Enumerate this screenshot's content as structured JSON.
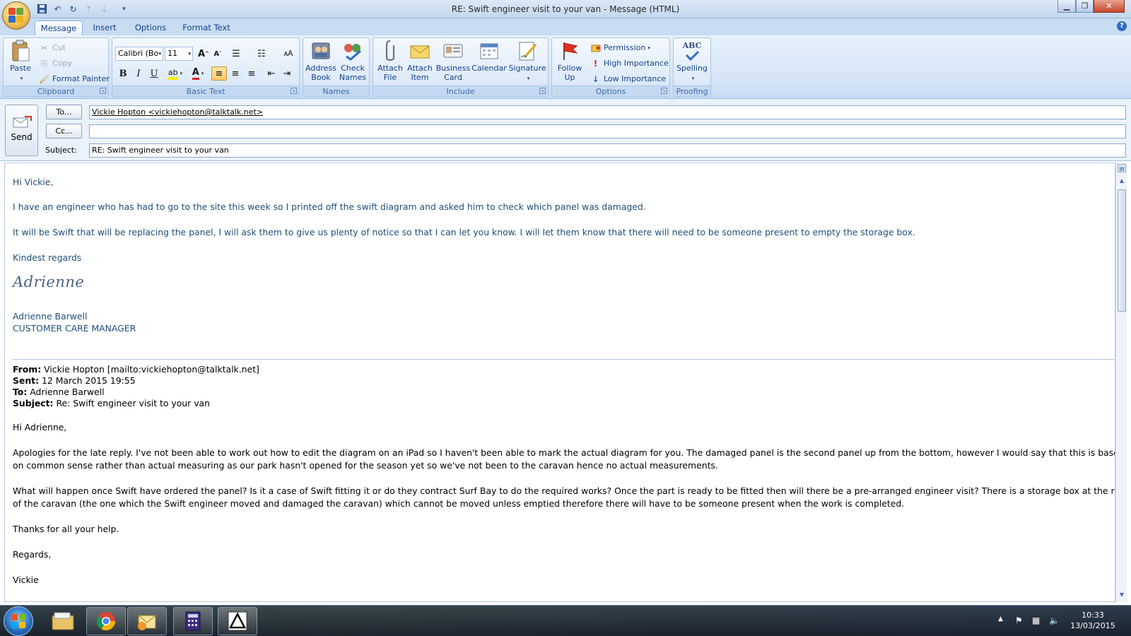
{
  "window": {
    "title": "RE: Swift engineer visit to your van - Message (HTML)",
    "qat_icons": [
      "save-icon",
      "undo-icon",
      "redo-icon",
      "up-arrow-icon",
      "down-arrow-icon",
      "customize-icon"
    ]
  },
  "tabs": [
    "Message",
    "Insert",
    "Options",
    "Format Text"
  ],
  "ribbon": {
    "clipboard": {
      "label": "Clipboard",
      "paste": "Paste",
      "cut": "Cut",
      "copy": "Copy",
      "format_painter": "Format Painter"
    },
    "basic_text": {
      "label": "Basic Text",
      "font": "Calibri (Bo",
      "size": "11"
    },
    "names": {
      "label": "Names",
      "address_book": "Address Book",
      "check_names": "Check Names"
    },
    "include": {
      "label": "Include",
      "attach_file": "Attach File",
      "attach_item": "Attach Item",
      "business_card": "Business Card",
      "calendar": "Calendar",
      "signature": "Signature"
    },
    "options": {
      "label": "Options",
      "follow_up": "Follow Up",
      "permission": "Permission",
      "high_importance": "High Importance",
      "low_importance": "Low Importance"
    },
    "proofing": {
      "label": "Proofing",
      "spelling": "Spelling",
      "abc": "ABC"
    }
  },
  "header": {
    "send": "Send",
    "to_button": "To...",
    "cc_button": "Cc...",
    "subject_label": "Subject:",
    "to_value": "Vickie Hopton <vickiehopton@talktalk.net>",
    "cc_value": "",
    "subject_value": "RE: Swift engineer visit to your van"
  },
  "body": {
    "greeting": "Hi Vickie,",
    "p1": "I have an engineer who has had to go to the site this week so I printed off the swift diagram and asked him to check which panel was damaged.",
    "p2": "It will be Swift that will be replacing the panel, I will ask them to give us plenty of notice so that I can let you know.  I will let them know that there will need to be someone present to empty the storage box.",
    "closing": "Kindest regards",
    "signature_script": "Adrienne",
    "sig_name": "Adrienne Barwell",
    "sig_title": "CUSTOMER CARE MANAGER",
    "quoted": {
      "from_label": "From:",
      "from": "Vickie Hopton [mailto:vickiehopton@talktalk.net]",
      "sent_label": "Sent:",
      "sent": "12 March 2015 19:55",
      "to_label": "To:",
      "to": "Adrienne Barwell",
      "subject_label": "Subject:",
      "subject": "Re: Swift engineer visit to your van",
      "greeting": "Hi Adrienne,",
      "p1a": "Apologies for the late reply.  I've not been able to work out how to edit the diagram on an iPad so I haven't been able to mark the actual diagram for you.  The damaged panel is the second panel up from the bottom, however I would say that this is based",
      "p1b": "on common sense rather than actual measuring as our park hasn't opened for the season yet so we've not been to the caravan  hence no actual measurements.",
      "p2a": "What will happen once Swift have ordered the panel?  Is it a case of Swift fitting it or do they contract Surf Bay to do the required works?  Once the part is ready to be fitted then will there be a pre-arranged engineer visit?  There is a storage box at the rear",
      "p2b": "of the caravan (the one which the Swift engineer moved and damaged the caravan) which cannot be moved unless emptied therefore there will have to be someone present when the work is completed.",
      "thanks": "Thanks for all your help.",
      "regards": "Regards,",
      "name": "Vickie"
    }
  },
  "taskbar": {
    "time": "10:33",
    "date": "13/03/2015",
    "items": [
      "explorer-icon",
      "chrome-icon",
      "outlook-icon",
      "calculator-icon",
      "adobe-reader-icon"
    ]
  }
}
